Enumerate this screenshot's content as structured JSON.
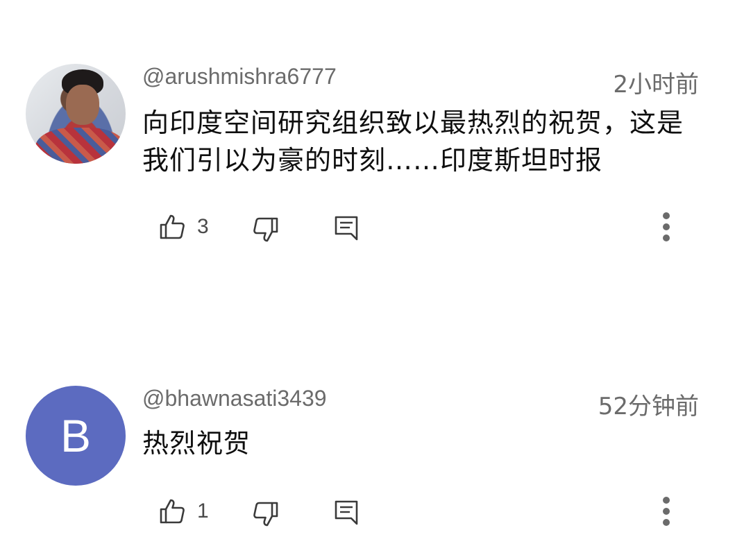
{
  "comments": [
    {
      "username": "@arushmishra6777",
      "timestamp": "2小时前",
      "text": "向印度空间研究组织致以最热烈的祝贺，这是我们引以为豪的时刻……印度斯坦时报",
      "like_count": "3",
      "avatar_type": "photo"
    },
    {
      "username": "@bhawnasati3439",
      "timestamp": "52分钟前",
      "text": "热烈祝贺",
      "like_count": "1",
      "avatar_type": "letter",
      "avatar_letter": "B",
      "avatar_color": "#5c6bc0"
    }
  ],
  "icons": {
    "like": "thumbs-up-icon",
    "dislike": "thumbs-down-icon",
    "reply": "reply-comment-icon",
    "more": "more-vertical-icon"
  }
}
